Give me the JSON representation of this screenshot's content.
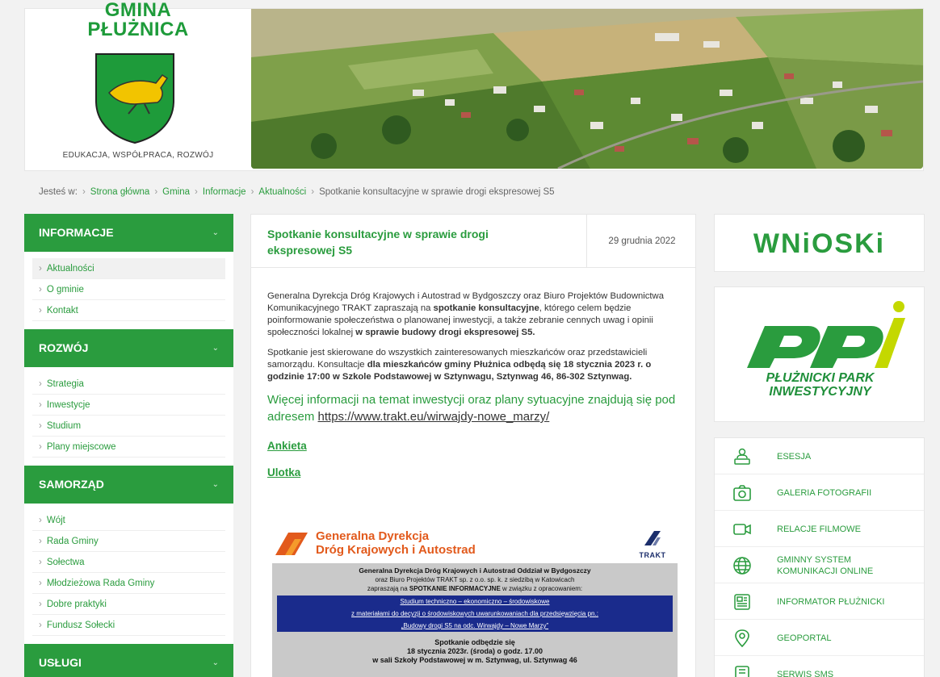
{
  "header": {
    "logo_line1": "GMINA",
    "logo_line2": "PŁUŻNICA",
    "tagline": "EDUKACJA, WSPÓŁPRACA, ROZWÓJ"
  },
  "breadcrumb": {
    "prefix": "Jesteś w:",
    "items": [
      "Strona główna",
      "Gmina",
      "Informacje",
      "Aktualności"
    ],
    "current": "Spotkanie konsultacyjne w sprawie drogi ekspresowej S5"
  },
  "sidebar": {
    "sections": [
      {
        "title": "INFORMACJE",
        "items": [
          "Aktualności",
          "O gminie",
          "Kontakt"
        ]
      },
      {
        "title": "ROZWÓJ",
        "items": [
          "Strategia",
          "Inwestycje",
          "Studium",
          "Plany miejscowe"
        ]
      },
      {
        "title": "SAMORZĄD",
        "items": [
          "Wójt",
          "Rada Gminy",
          "Sołectwa",
          "Młodzieżowa Rada Gminy",
          "Dobre praktyki",
          "Fundusz Sołecki"
        ]
      },
      {
        "title": "USŁUGI",
        "items": []
      }
    ]
  },
  "article": {
    "title": "Spotkanie konsultacyjne w sprawie drogi ekspresowej S5",
    "date": "29 grudnia 2022",
    "p1_a": "Generalna Dyrekcja Dróg Krajowych i Autostrad w Bydgoszczy oraz Biuro Projektów Budownictwa Komunikacyjnego TRAKT zapraszają na ",
    "p1_b": "spotkanie konsultacyjne",
    "p1_c": ", którego celem będzie poinformowanie społeczeństwa o planowanej inwestycji, a także zebranie cennych uwag i opinii społeczności lokalnej ",
    "p1_d": "w sprawie budowy drogi ekspresowej S5.",
    "p2_a": "Spotkanie jest skierowane do wszystkich zainteresowanych mieszkańców oraz przedstawicieli samorządu. Konsultacje ",
    "p2_b": "dla mieszkańców gminy Płużnica odbędą się 18 stycznia 2023 r. o godzinie 17:00 w Szkole Podstawowej w Sztynwagu, Sztynwag 46, 86-302 Sztynwag.",
    "more_text": "Więcej informacji na temat inwestycji oraz plany sytuacyjne znajdują się pod adresem ",
    "more_url": "https://www.trakt.eu/wirwajdy-nowe_marzy/",
    "link1": "Ankieta",
    "link2": "Ulotka"
  },
  "poster": {
    "gddka_l1": "Generalna Dyrekcja",
    "gddka_l2": "Dróg Krajowych i Autostrad",
    "trakt": "TRAKT",
    "line1": "Generalna Dyrekcja Dróg Krajowych i Autostrad Oddział w Bydgoszczy",
    "line2": "oraz Biuro Projektów TRAKT sp. z o.o. sp. k. z siedzibą w Katowicach",
    "line3_a": "zapraszają na ",
    "line3_b": "SPOTKANIE INFORMACYJNE",
    "line3_c": " w związku z opracowaniem:",
    "blue1": "Studium techniczno – ekonomiczno – środowiskowe",
    "blue2": "z materiałami do decyzji o środowiskowych uwarunkowaniach dla przedsięwzięcia pn.:",
    "blue3": "„Budowy drogi S5 na odc. Wirwajdy – Nowe Marzy”",
    "meet1": "Spotkanie odbędzie się",
    "meet2": "18 stycznia 2023r. (środa) o godz. 17.00",
    "meet3": "w sali Szkoły Podstawowej w m. Sztynwag, ul. Sztynwag 46"
  },
  "right": {
    "wnioski": "WNiOSKi",
    "ppi_l1": "PŁUŻNICKI PARK",
    "ppi_l2": "INWESTYCYJNY",
    "links": [
      {
        "label": "ESESJA",
        "icon": "person-podium-icon"
      },
      {
        "label": "GALERIA FOTOGRAFII",
        "icon": "camera-icon"
      },
      {
        "label": "RELACJE FILMOWE",
        "icon": "video-camera-icon"
      },
      {
        "label": "GMINNY SYSTEM KOMUNIKACJI ONLINE",
        "icon": "globe-icon"
      },
      {
        "label": "INFORMATOR PŁUŻNICKI",
        "icon": "newspaper-icon"
      },
      {
        "label": "GEOPORTAL",
        "icon": "map-pin-icon"
      },
      {
        "label": "SERWIS SMS",
        "icon": "phone-icon"
      }
    ]
  },
  "colors": {
    "green": "#2a9c3e",
    "orange": "#e25a1c",
    "navy": "#1a2b8c"
  }
}
